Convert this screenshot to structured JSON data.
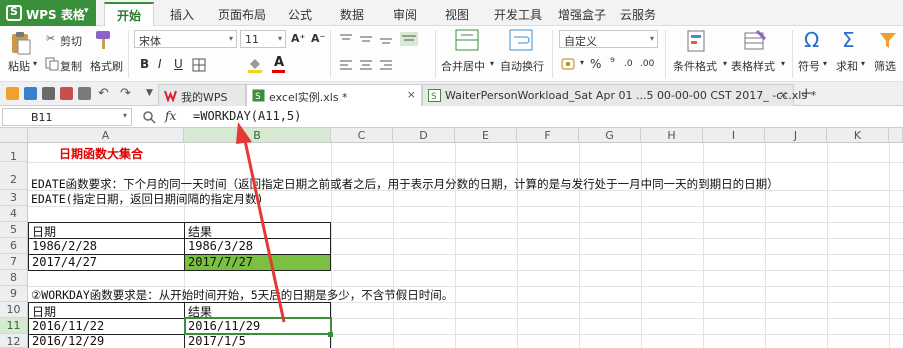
{
  "app": {
    "title": "WPS 表格"
  },
  "menu": {
    "items": [
      "开始",
      "插入",
      "页面布局",
      "公式",
      "数据",
      "审阅",
      "视图",
      "开发工具",
      "增强盒子",
      "云服务"
    ]
  },
  "ribbon": {
    "paste": "粘贴",
    "cut": "剪切",
    "copy": "复制",
    "format_painter": "格式刷",
    "font_name": "宋体",
    "font_size": "11",
    "bold": "B",
    "italic": "I",
    "underline": "U",
    "merge_center": "合并居中",
    "wrap": "自动换行",
    "number_format": "自定义",
    "percent": "%",
    "comma": "⁹",
    "cond_format": "条件格式",
    "table_style": "表格样式",
    "symbol": "符号",
    "sum": "求和",
    "filter": "筛选",
    "omega": "Ω",
    "sigma": "Σ",
    "font_grow": "A⁺",
    "font_shrink": "A⁻",
    "font_color": "A"
  },
  "tabs": [
    {
      "label": "我的WPS",
      "active": false
    },
    {
      "label": "excel实例.xls *",
      "active": true
    },
    {
      "label": "WaiterPersonWorkload_Sat Apr 01 ...5 00-00-00 CST 2017_ -cc.xls *",
      "active": false
    }
  ],
  "tabbar": {
    "add": "+",
    "close": "×",
    "more": "▼"
  },
  "formula_bar": {
    "cell_ref": "B11",
    "fx": "fx",
    "formula": "=WORKDAY(A11,5)"
  },
  "columns": [
    "A",
    "B",
    "C",
    "D",
    "E",
    "F",
    "G",
    "H",
    "I",
    "J",
    "K"
  ],
  "rows": [
    "1",
    "2",
    "3",
    "4",
    "5",
    "6",
    "7",
    "8",
    "9",
    "10",
    "11",
    "12"
  ],
  "cells": {
    "a1": "日期函数大集合",
    "a2": "EDATE函数要求：下个月的同一天时间（返回指定日期之前或者之后，用于表示月分数的日期，计算的是与发行处于一月中同一天的到期日的日期）",
    "a3": "EDATE(指定日期，返回日期间隔的指定月数)",
    "a5": "日期",
    "b5": "结果",
    "a6": "1986/2/28",
    "b6": "1986/3/28",
    "a7": "2017/4/27",
    "b7": "2017/7/27",
    "a9": "②WORKDAY函数要求是：从开始时间开始，5天后的日期是多少，不含节假日时间。",
    "a10": "日期",
    "b10": "结果",
    "a11": "2016/11/22",
    "b11": "2016/11/29",
    "a12": "2016/12/29",
    "b12": "2017/1/5"
  },
  "colors": {
    "accent": "#3a8f3a",
    "highlight_fill": "#7bc043",
    "title_red": "#e00000",
    "arrow": "#e53935"
  },
  "icons": [
    "paste-icon",
    "cut-icon",
    "copy-icon",
    "format-painter-icon",
    "fill-color-icon",
    "font-color-icon",
    "merge-icon",
    "wrap-icon",
    "cond-format-icon",
    "table-style-icon",
    "symbol-icon",
    "sum-icon",
    "filter-icon",
    "save-icon",
    "print-icon",
    "undo-icon",
    "redo-icon",
    "search-icon"
  ]
}
